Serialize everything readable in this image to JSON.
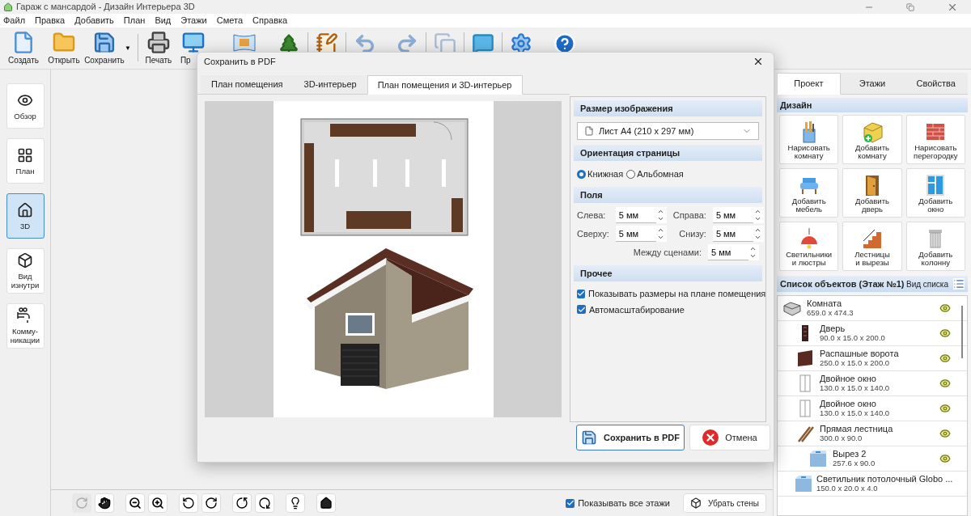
{
  "window": {
    "title": "Гараж с мансардой - Дизайн Интерьера 3D"
  },
  "menu": [
    "Файл",
    "Правка",
    "Добавить",
    "План",
    "Вид",
    "Этажи",
    "Смета",
    "Справка"
  ],
  "toolbar": [
    {
      "label": "Создать"
    },
    {
      "label": "Открыть"
    },
    {
      "label": "Сохранить"
    },
    {
      "label": "Печать"
    },
    {
      "label": "Пр"
    }
  ],
  "toolbar_dropdown": "▼",
  "sidebar": [
    {
      "label": "Обзор",
      "selected": false
    },
    {
      "label": "План",
      "selected": false
    },
    {
      "label": "3D",
      "selected": true
    },
    {
      "label": "Вид\nизнутри",
      "selected": false
    },
    {
      "label": "Комму-\nникации",
      "selected": false
    }
  ],
  "bottom_bar": {
    "show_all_floors": {
      "label": "Показывать все этажи",
      "checked": true
    },
    "remove_walls": "Убрать стены"
  },
  "right_panel": {
    "tabs": [
      {
        "label": "Проект",
        "selected": true
      },
      {
        "label": "Этажи",
        "selected": false
      },
      {
        "label": "Свойства",
        "selected": false
      }
    ],
    "design_title": "Дизайн",
    "design_tiles": [
      "Нарисовать\nкомнату",
      "Добавить\nкомнату",
      "Нарисовать\nперегородку",
      "Добавить\nмебель",
      "Добавить\nдверь",
      "Добавить\nокно",
      "Светильники\nи люстры",
      "Лестницы\nи вырезы",
      "Добавить\nколонну"
    ],
    "objects_title": "Список объектов (Этаж №1)",
    "list_view": "Вид списка",
    "objects": [
      {
        "name": "Комната",
        "size": "659.0 x 474.3",
        "children": [
          {
            "name": "Дверь",
            "size": "90.0 x 15.0 x 200.0"
          },
          {
            "name": "Распашные ворота",
            "size": "250.0 x 15.0 x 200.0"
          },
          {
            "name": "Двойное окно",
            "size": "130.0 x 15.0 x 140.0"
          },
          {
            "name": "Двойное окно",
            "size": "130.0 x 15.0 x 140.0"
          },
          {
            "name": "Прямая лестница",
            "size": "300.0 x 90.0",
            "children": [
              {
                "name": "Вырез 2",
                "size": "257.6 x 90.0"
              }
            ]
          },
          {
            "name": "Светильник потолочный Globo ...",
            "size": "150.0 x 20.0 x 4.0"
          }
        ]
      }
    ]
  },
  "dialog": {
    "title": "Сохранить в PDF",
    "tabs": [
      {
        "label": "План помещения",
        "selected": false
      },
      {
        "label": "3D-интерьер",
        "selected": false
      },
      {
        "label": "План помещения и 3D-интерьер",
        "selected": true
      }
    ],
    "image_size_title": "Размер изображения",
    "paper": "Лист А4 (210 x 297 мм)",
    "orientation_title": "Ориентация страницы",
    "orientation": [
      {
        "label": "Книжная",
        "selected": true
      },
      {
        "label": "Альбомная",
        "selected": false
      }
    ],
    "margins_title": "Поля",
    "margins": [
      {
        "label": "Слева:",
        "value": "5 мм"
      },
      {
        "label": "Справа:",
        "value": "5 мм"
      },
      {
        "label": "Сверху:",
        "value": "5 мм"
      },
      {
        "label": "Снизу:",
        "value": "5 мм"
      },
      {
        "label": "Между сценами:",
        "value": "5 мм"
      }
    ],
    "other_title": "Прочее",
    "options": [
      {
        "label": "Показывать размеры на плане помещения",
        "checked": true
      },
      {
        "label": "Автомасштабирование",
        "checked": true
      }
    ],
    "save_button": "Сохранить в PDF",
    "cancel_button": "Отмена"
  }
}
